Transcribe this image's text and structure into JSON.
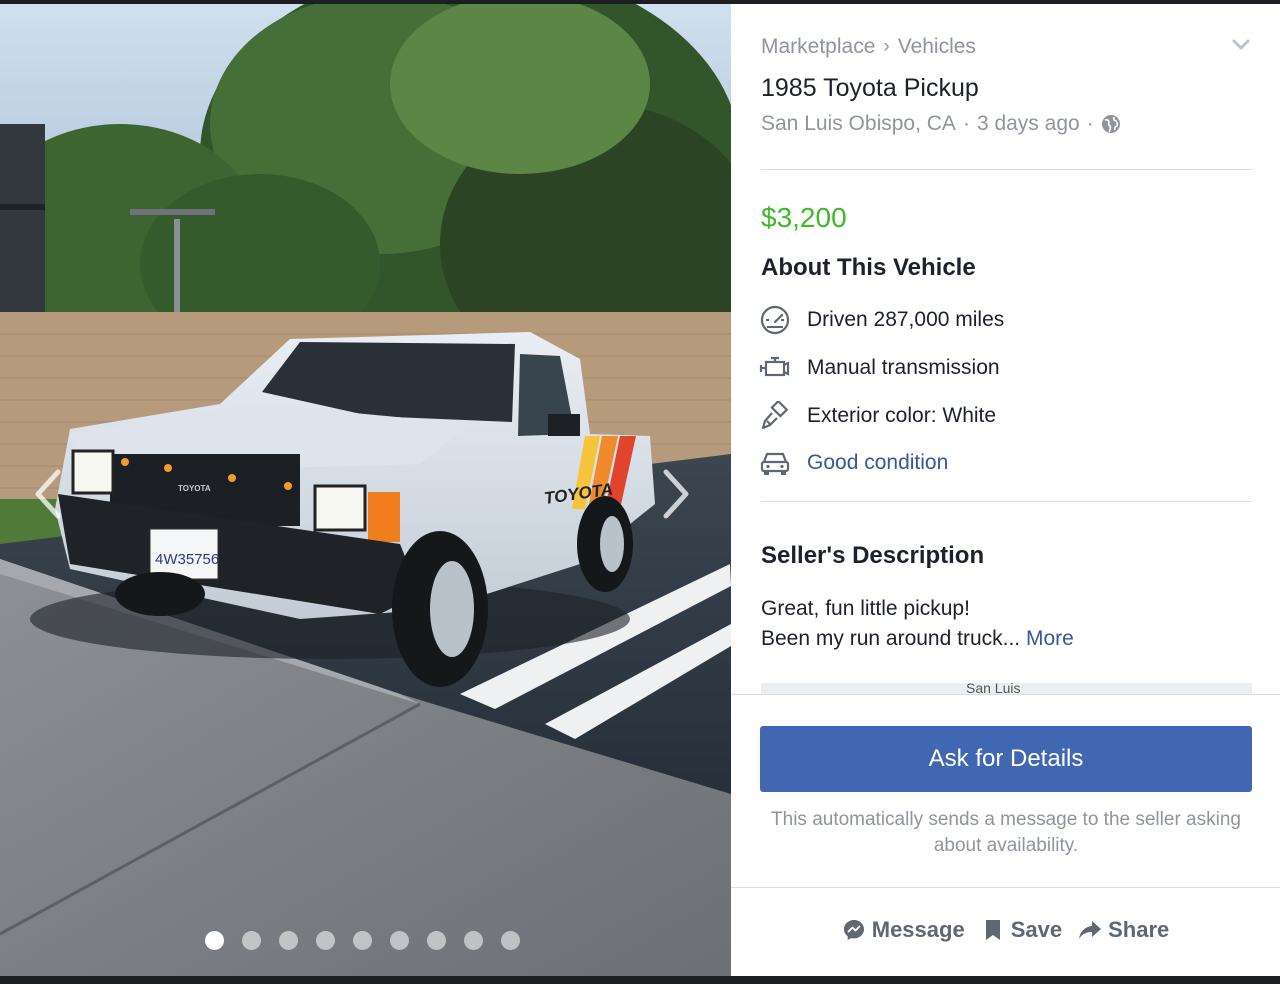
{
  "listing": {
    "breadcrumb": [
      "Marketplace",
      "Vehicles"
    ],
    "breadcrumb_separator": "›",
    "title": "1985 Toyota Pickup",
    "location": "San Luis Obispo, CA",
    "posted": "3 days ago",
    "meta_separator": "·",
    "price": "$3,200"
  },
  "about": {
    "heading": "About This Vehicle",
    "features": [
      {
        "icon": "speedometer-icon",
        "text": "Driven 287,000 miles"
      },
      {
        "icon": "engine-icon",
        "text": "Manual transmission"
      },
      {
        "icon": "paintbrush-icon",
        "text": "Exterior color: White"
      },
      {
        "icon": "car-icon",
        "text": "Good condition"
      }
    ]
  },
  "seller": {
    "heading": "Seller's Description",
    "line1": "Great, fun little pickup!",
    "line2": "Been my run around truck...",
    "more_label": "More"
  },
  "map": {
    "label": "San Luis"
  },
  "cta": {
    "button_label": "Ask for Details",
    "hint": "This automatically sends a message to the seller asking about availability."
  },
  "actions": {
    "message": "Message",
    "save": "Save",
    "share": "Share"
  },
  "photo": {
    "truck_brand": "TOYOTA",
    "plate": "4W35756",
    "image_count": 9,
    "active_index": 0
  },
  "colors": {
    "accent": "#4267b2",
    "price": "#42b72a",
    "link": "#365899",
    "muted": "#90949c"
  }
}
